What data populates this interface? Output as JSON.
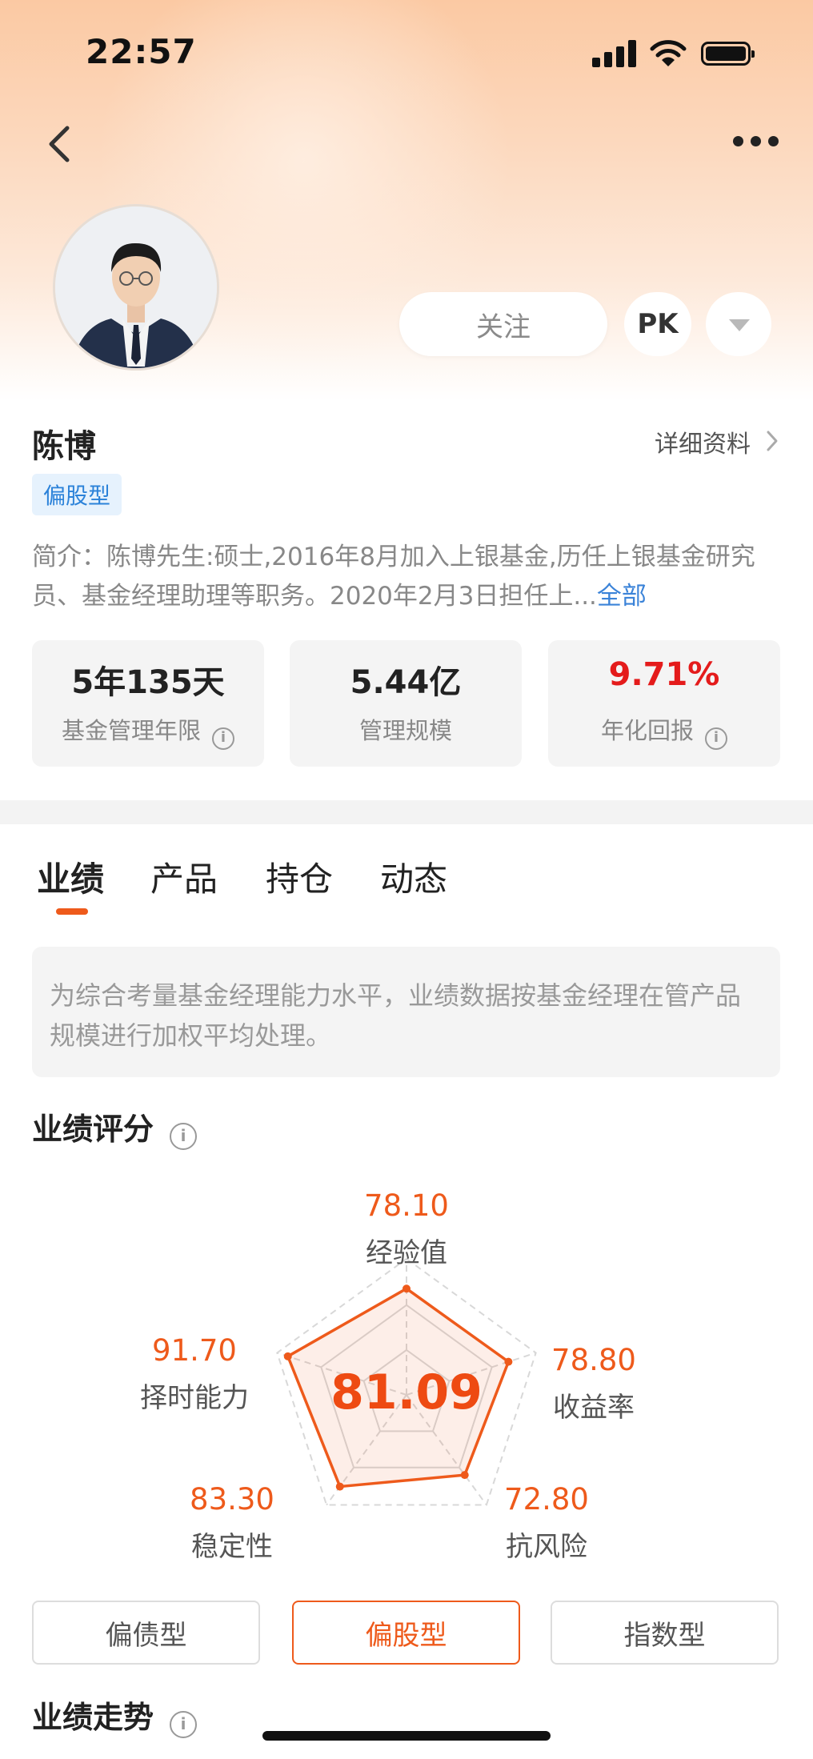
{
  "status_bar": {
    "time": "22:57"
  },
  "header": {
    "follow_label": "关注",
    "pk_label": "PK"
  },
  "manager": {
    "name": "陈博",
    "detail_link": "详细资料",
    "type_tag": "偏股型",
    "intro_text": "简介：陈博先生:硕士,2016年8月加入上银基金,历任上银基金研究员、基金经理助理等职务。2020年2月3日担任上...",
    "intro_more": "全部"
  },
  "stats": [
    {
      "value": "5年135天",
      "label": "基金管理年限",
      "has_info": true,
      "highlight": false
    },
    {
      "value": "5.44亿",
      "label": "管理规模",
      "has_info": false,
      "highlight": false
    },
    {
      "value": "9.71%",
      "label": "年化回报",
      "has_info": true,
      "highlight": true
    }
  ],
  "tabs": [
    {
      "label": "业绩",
      "active": true
    },
    {
      "label": "产品",
      "active": false
    },
    {
      "label": "持仓",
      "active": false
    },
    {
      "label": "动态",
      "active": false
    }
  ],
  "notice": "为综合考量基金经理能力水平，业绩数据按基金经理在管产品规模进行加权平均处理。",
  "score_section": {
    "title": "业绩评分",
    "total": "81.09",
    "dimensions": [
      {
        "name": "经验值",
        "value": "78.10",
        "score": 78.1
      },
      {
        "name": "收益率",
        "value": "78.80",
        "score": 78.8
      },
      {
        "name": "抗风险",
        "value": "72.80",
        "score": 72.8
      },
      {
        "name": "稳定性",
        "value": "83.30",
        "score": 83.3
      },
      {
        "name": "择时能力",
        "value": "91.70",
        "score": 91.7
      }
    ]
  },
  "type_buttons": [
    {
      "label": "偏债型",
      "active": false
    },
    {
      "label": "偏股型",
      "active": true
    },
    {
      "label": "指数型",
      "active": false
    }
  ],
  "trend_section": {
    "title": "业绩走势"
  },
  "colors": {
    "accent": "#ee5a1b",
    "red": "#e41b1b",
    "link": "#3b83d8",
    "tag_bg": "#e6f2fd"
  }
}
